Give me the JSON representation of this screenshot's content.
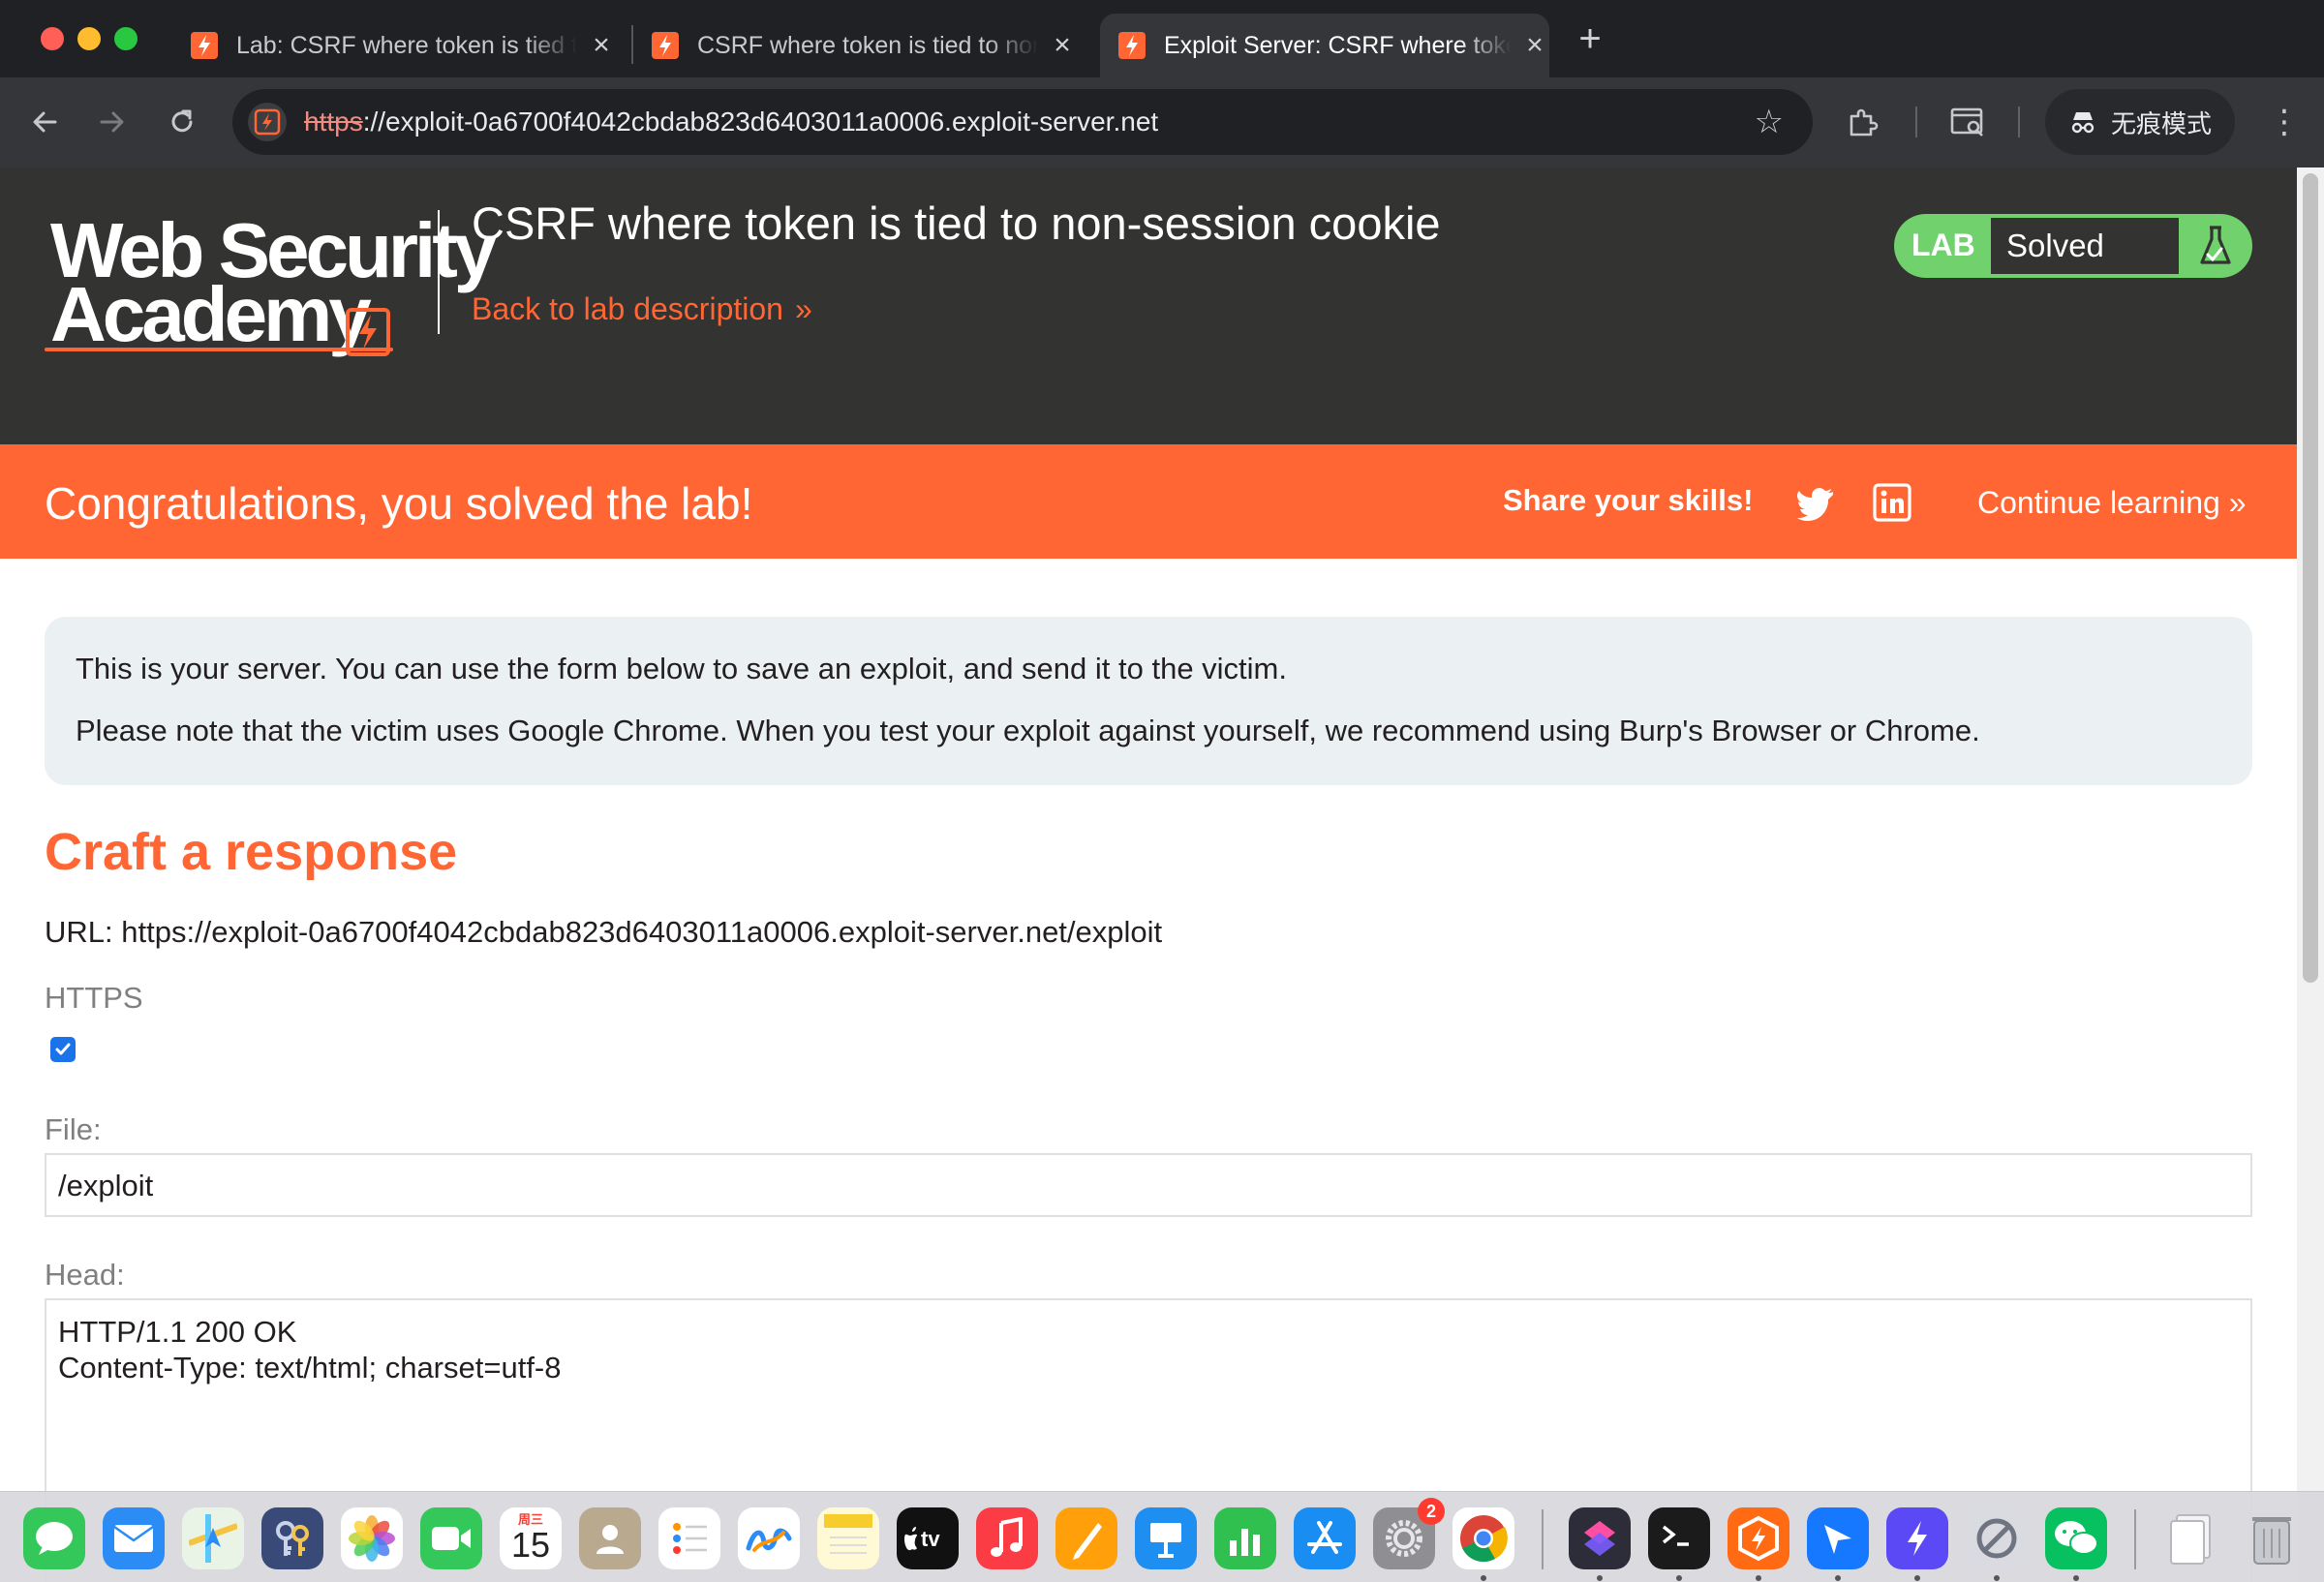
{
  "browser": {
    "tabs": [
      {
        "title": "Lab: CSRF where token is tied to non-session cookie",
        "active": false
      },
      {
        "title": "CSRF where token is tied to non-session cookie",
        "active": false
      },
      {
        "title": "Exploit Server: CSRF where token is tied to non-session cookie",
        "active": true
      }
    ],
    "url_scheme": "https",
    "url_rest": "://exploit-0a6700f4042cbdab823d6403011a0006.exploit-server.net",
    "incognito_label": "无痕模式"
  },
  "header": {
    "logo_line1": "Web Security",
    "logo_line2": "Academy",
    "lab_title": "CSRF where token is tied to non-session cookie",
    "back_link": "Back to lab description",
    "badge_label": "LAB",
    "badge_status": "Solved"
  },
  "banner": {
    "congrats": "Congratulations, you solved the lab!",
    "share": "Share your skills!",
    "continue": "Continue learning"
  },
  "info": {
    "p1": "This is your server. You can use the form below to save an exploit, and send it to the victim.",
    "p2": "Please note that the victim uses Google Chrome. When you test your exploit against yourself, we recommend using Burp's Browser or Chrome."
  },
  "form": {
    "heading": "Craft a response",
    "url_line": "URL: https://exploit-0a6700f4042cbdab823d6403011a0006.exploit-server.net/exploit",
    "https_label": "HTTPS",
    "https_checked": true,
    "file_label": "File:",
    "file_value": "/exploit",
    "head_label": "Head:",
    "head_value": "HTTP/1.1 200 OK\nContent-Type: text/html; charset=utf-8"
  },
  "dock": {
    "calendar_month": "周三",
    "calendar_day": "15",
    "settings_badge": "2"
  },
  "colors": {
    "accent": "#ff6633",
    "header_bg": "#333332",
    "lab_green": "#70d16d",
    "info_bg": "#ebf0f2"
  }
}
